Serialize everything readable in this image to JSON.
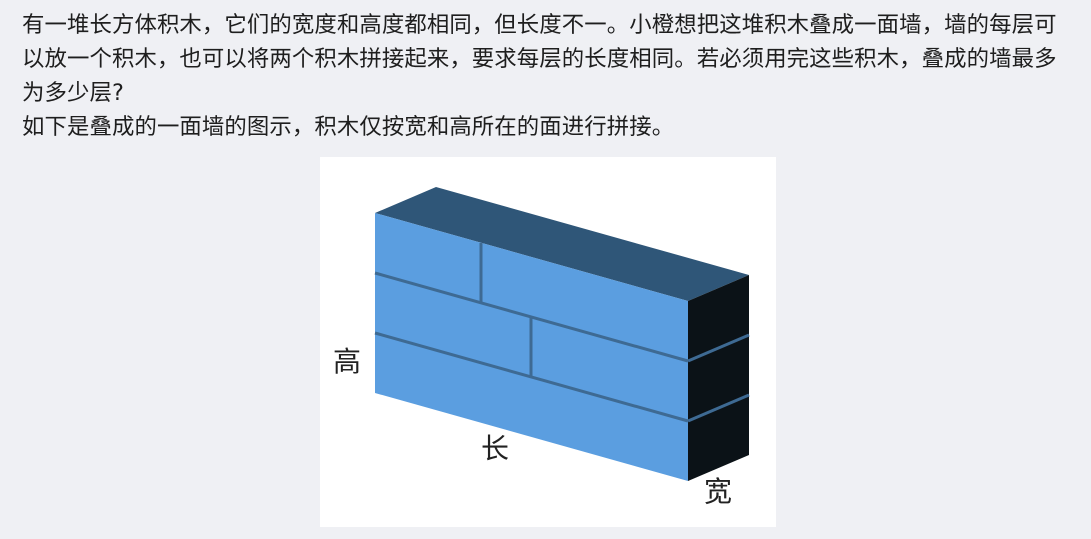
{
  "problem": {
    "paragraph1": "有一堆长方体积木，它们的宽度和高度都相同，但长度不一。小橙想把这堆积木叠成一面墙，墙的每层可以放一个积木，也可以将两个积木拼接起来，要求每层的长度相同。若必须用完这些积木，叠成的墙最多为多少层?",
    "paragraph2": "如下是叠成的一面墙的图示，积木仅按宽和高所在的面进行拼接。"
  },
  "figure": {
    "labels": {
      "height": "高",
      "length": "长",
      "width": "宽"
    },
    "colors": {
      "front_face": "#5b9ee0",
      "top_face": "#2f5678",
      "side_face": "#0b1217",
      "seam": "#3e6a93"
    }
  }
}
